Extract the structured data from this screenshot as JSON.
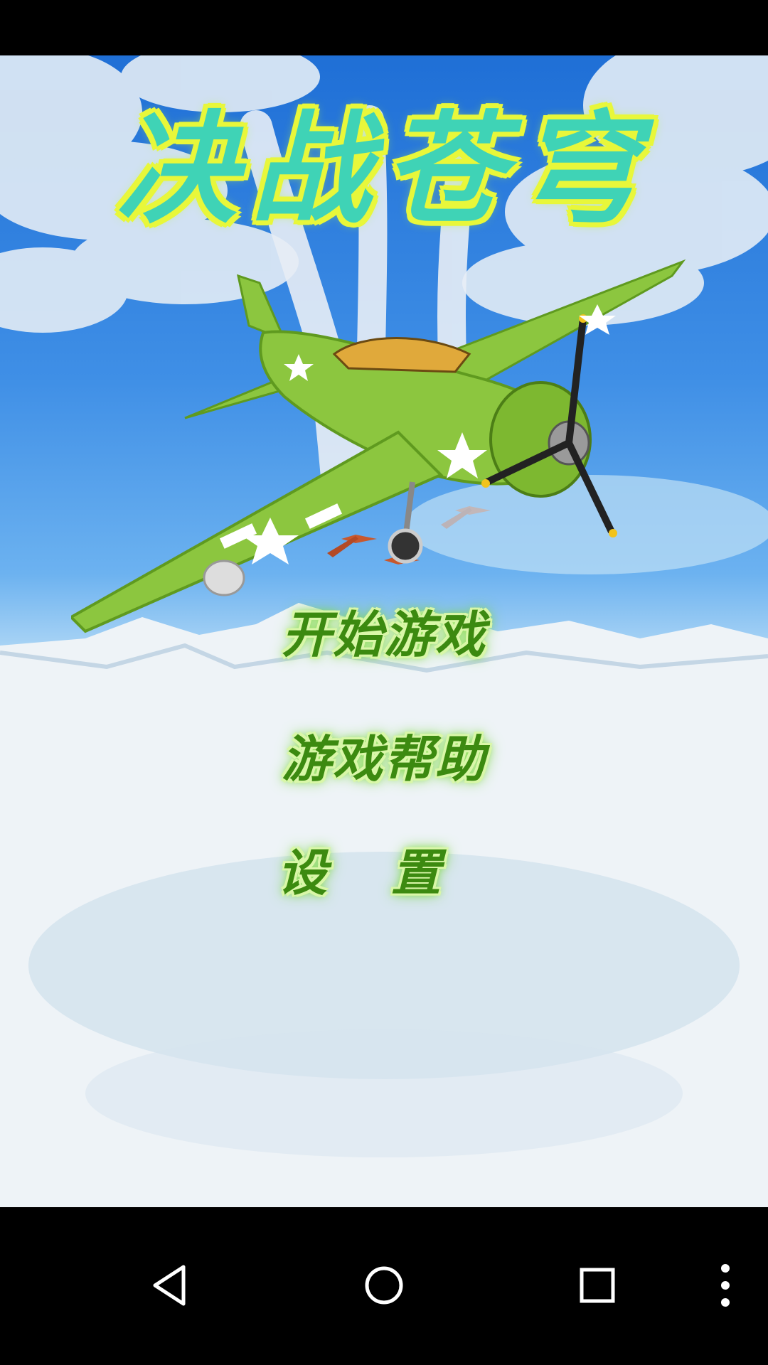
{
  "game": {
    "title": "决战苍穹"
  },
  "menu": {
    "start_label": "开始游戏",
    "help_label": "游戏帮助",
    "settings_label": "设置"
  },
  "nav": {
    "back_icon": "back-icon",
    "home_icon": "home-icon",
    "recents_icon": "recents-icon",
    "more_icon": "more-vert-icon"
  },
  "colors": {
    "title_fill": "#3fd3b6",
    "title_outline": "#e8f73a",
    "menu_text": "#3c8a10",
    "plane_body": "#8cc63f"
  }
}
